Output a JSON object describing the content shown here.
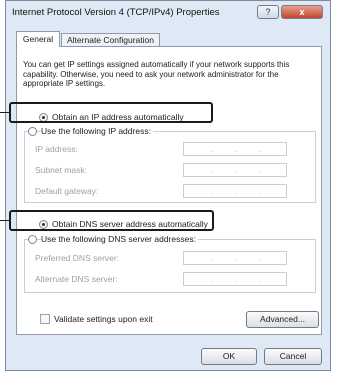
{
  "window": {
    "title": "Internet Protocol Version 4 (TCP/IPv4) Properties",
    "help_glyph": "?",
    "close_glyph": "x"
  },
  "tabs": [
    {
      "label": "General"
    },
    {
      "label": "Alternate Configuration"
    }
  ],
  "intro_text": "You can get IP settings assigned automatically if your network supports this capability. Otherwise, you need to ask your network administrator for the appropriate IP settings.",
  "ip_section": {
    "auto_label": "Obtain an IP address automatically",
    "manual_label": "Use the following IP address:",
    "fields": [
      {
        "label": "IP address:"
      },
      {
        "label": "Subnet mask:"
      },
      {
        "label": "Default gateway:"
      }
    ]
  },
  "dns_section": {
    "auto_label": "Obtain DNS server address automatically",
    "manual_label": "Use the following DNS server addresses:",
    "fields": [
      {
        "label": "Preferred DNS server:"
      },
      {
        "label": "Alternate DNS server:"
      }
    ]
  },
  "ip_dot": ".",
  "validate_label": "Validate settings upon exit",
  "buttons": {
    "advanced": "Advanced...",
    "ok": "OK",
    "cancel": "Cancel"
  },
  "selected": {
    "ip_mode": "automatic",
    "dns_mode": "automatic",
    "validate_checked": false
  }
}
